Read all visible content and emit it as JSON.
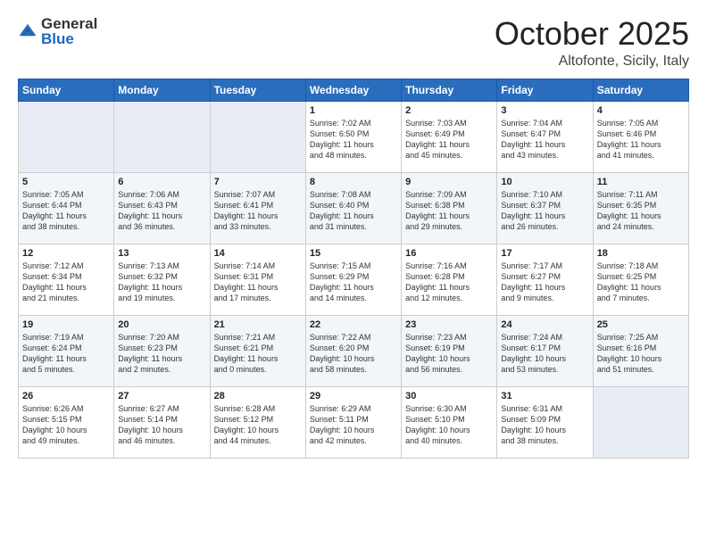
{
  "header": {
    "logo_general": "General",
    "logo_blue": "Blue",
    "month": "October 2025",
    "location": "Altofonte, Sicily, Italy"
  },
  "weekdays": [
    "Sunday",
    "Monday",
    "Tuesday",
    "Wednesday",
    "Thursday",
    "Friday",
    "Saturday"
  ],
  "weeks": [
    [
      {
        "day": "",
        "info": ""
      },
      {
        "day": "",
        "info": ""
      },
      {
        "day": "",
        "info": ""
      },
      {
        "day": "1",
        "info": "Sunrise: 7:02 AM\nSunset: 6:50 PM\nDaylight: 11 hours\nand 48 minutes."
      },
      {
        "day": "2",
        "info": "Sunrise: 7:03 AM\nSunset: 6:49 PM\nDaylight: 11 hours\nand 45 minutes."
      },
      {
        "day": "3",
        "info": "Sunrise: 7:04 AM\nSunset: 6:47 PM\nDaylight: 11 hours\nand 43 minutes."
      },
      {
        "day": "4",
        "info": "Sunrise: 7:05 AM\nSunset: 6:46 PM\nDaylight: 11 hours\nand 41 minutes."
      }
    ],
    [
      {
        "day": "5",
        "info": "Sunrise: 7:05 AM\nSunset: 6:44 PM\nDaylight: 11 hours\nand 38 minutes."
      },
      {
        "day": "6",
        "info": "Sunrise: 7:06 AM\nSunset: 6:43 PM\nDaylight: 11 hours\nand 36 minutes."
      },
      {
        "day": "7",
        "info": "Sunrise: 7:07 AM\nSunset: 6:41 PM\nDaylight: 11 hours\nand 33 minutes."
      },
      {
        "day": "8",
        "info": "Sunrise: 7:08 AM\nSunset: 6:40 PM\nDaylight: 11 hours\nand 31 minutes."
      },
      {
        "day": "9",
        "info": "Sunrise: 7:09 AM\nSunset: 6:38 PM\nDaylight: 11 hours\nand 29 minutes."
      },
      {
        "day": "10",
        "info": "Sunrise: 7:10 AM\nSunset: 6:37 PM\nDaylight: 11 hours\nand 26 minutes."
      },
      {
        "day": "11",
        "info": "Sunrise: 7:11 AM\nSunset: 6:35 PM\nDaylight: 11 hours\nand 24 minutes."
      }
    ],
    [
      {
        "day": "12",
        "info": "Sunrise: 7:12 AM\nSunset: 6:34 PM\nDaylight: 11 hours\nand 21 minutes."
      },
      {
        "day": "13",
        "info": "Sunrise: 7:13 AM\nSunset: 6:32 PM\nDaylight: 11 hours\nand 19 minutes."
      },
      {
        "day": "14",
        "info": "Sunrise: 7:14 AM\nSunset: 6:31 PM\nDaylight: 11 hours\nand 17 minutes."
      },
      {
        "day": "15",
        "info": "Sunrise: 7:15 AM\nSunset: 6:29 PM\nDaylight: 11 hours\nand 14 minutes."
      },
      {
        "day": "16",
        "info": "Sunrise: 7:16 AM\nSunset: 6:28 PM\nDaylight: 11 hours\nand 12 minutes."
      },
      {
        "day": "17",
        "info": "Sunrise: 7:17 AM\nSunset: 6:27 PM\nDaylight: 11 hours\nand 9 minutes."
      },
      {
        "day": "18",
        "info": "Sunrise: 7:18 AM\nSunset: 6:25 PM\nDaylight: 11 hours\nand 7 minutes."
      }
    ],
    [
      {
        "day": "19",
        "info": "Sunrise: 7:19 AM\nSunset: 6:24 PM\nDaylight: 11 hours\nand 5 minutes."
      },
      {
        "day": "20",
        "info": "Sunrise: 7:20 AM\nSunset: 6:23 PM\nDaylight: 11 hours\nand 2 minutes."
      },
      {
        "day": "21",
        "info": "Sunrise: 7:21 AM\nSunset: 6:21 PM\nDaylight: 11 hours\nand 0 minutes."
      },
      {
        "day": "22",
        "info": "Sunrise: 7:22 AM\nSunset: 6:20 PM\nDaylight: 10 hours\nand 58 minutes."
      },
      {
        "day": "23",
        "info": "Sunrise: 7:23 AM\nSunset: 6:19 PM\nDaylight: 10 hours\nand 56 minutes."
      },
      {
        "day": "24",
        "info": "Sunrise: 7:24 AM\nSunset: 6:17 PM\nDaylight: 10 hours\nand 53 minutes."
      },
      {
        "day": "25",
        "info": "Sunrise: 7:25 AM\nSunset: 6:16 PM\nDaylight: 10 hours\nand 51 minutes."
      }
    ],
    [
      {
        "day": "26",
        "info": "Sunrise: 6:26 AM\nSunset: 5:15 PM\nDaylight: 10 hours\nand 49 minutes."
      },
      {
        "day": "27",
        "info": "Sunrise: 6:27 AM\nSunset: 5:14 PM\nDaylight: 10 hours\nand 46 minutes."
      },
      {
        "day": "28",
        "info": "Sunrise: 6:28 AM\nSunset: 5:12 PM\nDaylight: 10 hours\nand 44 minutes."
      },
      {
        "day": "29",
        "info": "Sunrise: 6:29 AM\nSunset: 5:11 PM\nDaylight: 10 hours\nand 42 minutes."
      },
      {
        "day": "30",
        "info": "Sunrise: 6:30 AM\nSunset: 5:10 PM\nDaylight: 10 hours\nand 40 minutes."
      },
      {
        "day": "31",
        "info": "Sunrise: 6:31 AM\nSunset: 5:09 PM\nDaylight: 10 hours\nand 38 minutes."
      },
      {
        "day": "",
        "info": ""
      }
    ]
  ]
}
